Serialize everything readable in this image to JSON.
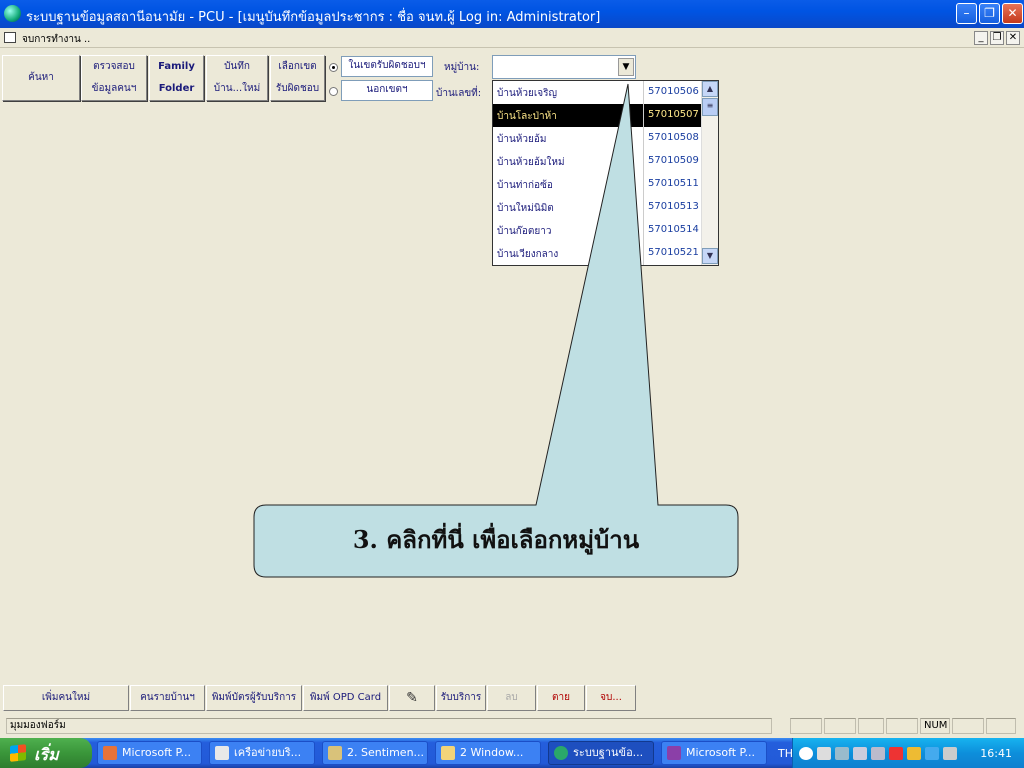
{
  "window": {
    "title": "ระบบฐานข้อมูลสถานีอนามัย - PCU - [เมนูบันทึกข้อมูลประชากร : ชื่อ จนท.ผู้ Log in: Administrator]",
    "child_title": "จบการทำงาน .."
  },
  "toolbar": {
    "search_label": "ค้นหา",
    "check_label_1": "ตรวจสอบ",
    "check_label_2": "ข้อมูลคนฯ",
    "family_label_1": "Family",
    "family_label_2": "Folder",
    "record_label_1": "บันทึก",
    "record_label_2": "บ้าน...ใหม่",
    "select_zone_label_1": "เลือกเขต",
    "select_zone_label_2": "รับผิดชอบ",
    "radio_inside_label": "ในเขตรับผิดชอบฯ",
    "radio_outside_label": "นอกเขตฯ",
    "radio_selected": "inside",
    "village_label": "หมู่บ้าน:",
    "house_no_label": "บ้านเลขที่:",
    "village_value": ""
  },
  "village_list": {
    "items": [
      {
        "name": "บ้านห้วยเจริญ",
        "code": "57010506",
        "selected": false
      },
      {
        "name": "บ้านโละป่าห้า",
        "code": "57010507",
        "selected": true
      },
      {
        "name": "บ้านห้วยอ้ม",
        "code": "57010508",
        "selected": false
      },
      {
        "name": "บ้านห้วยอ้มใหม่",
        "code": "57010509",
        "selected": false
      },
      {
        "name": "บ้านท่าก่อซ้อ",
        "code": "57010511",
        "selected": false
      },
      {
        "name": "บ้านใหม่นิมิต",
        "code": "57010513",
        "selected": false
      },
      {
        "name": "บ้านก๊อตยาว",
        "code": "57010514",
        "selected": false
      },
      {
        "name": "บ้านเวียงกลาง",
        "code": "57010521",
        "selected": false
      }
    ]
  },
  "callout": {
    "text": "3. คลิกที่นี่ เพื่อเลือกหมู่บ้าน",
    "fill": "#bfdfe3"
  },
  "bottom_bar": {
    "add_person": "เพิ่มคนใหม่",
    "persons_by_house": "คนรายบ้านฯ",
    "print_card": "พิมพ์บัตรผู้รับบริการ",
    "print_opd": "พิมพ์ OPD Card",
    "service": "รับบริการ",
    "delete": "ลบ",
    "death": "ตาย",
    "end": "จบ..."
  },
  "status_bar": {
    "text": "มุมมองฟอร์ม",
    "num": "NUM"
  },
  "taskbar": {
    "start_label": "เริ่ม",
    "tasks": [
      "Microsoft P...",
      "เครือข่ายบริ...",
      "2. Sentimen...",
      "2 Window...",
      "ระบบฐานข้อ...",
      "Microsoft P..."
    ],
    "language": "TH",
    "clock": "16:41"
  }
}
